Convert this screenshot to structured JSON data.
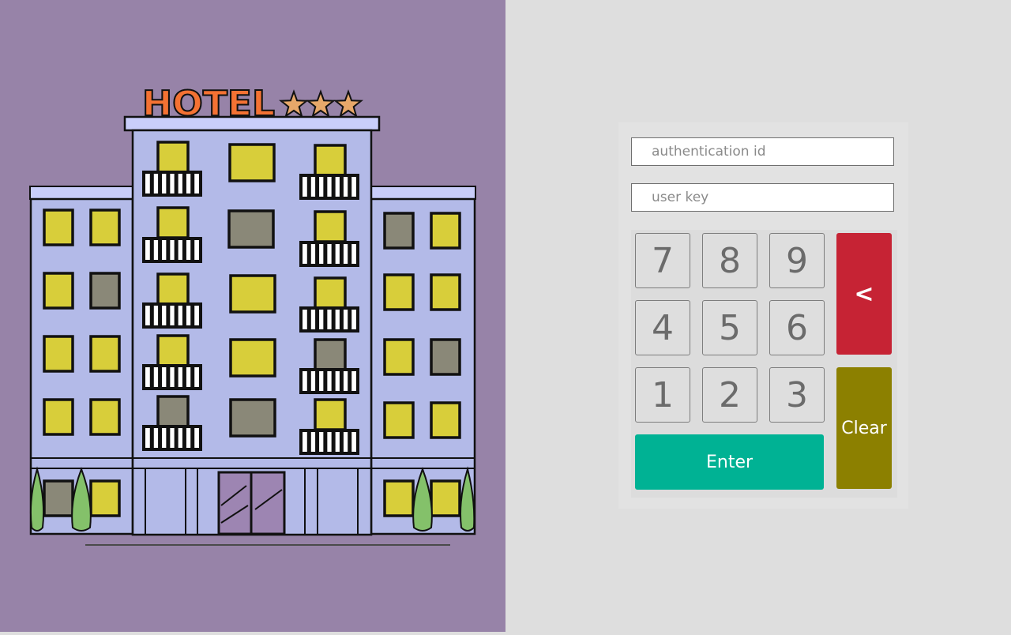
{
  "illustration": {
    "sign_text": "HOTEL",
    "star_count": 3,
    "colors": {
      "background": "#9783a8",
      "building": "#b3bae8",
      "window_lit": "#d8ce3a",
      "window_dark": "#8a8878",
      "sign": "#f47233",
      "stars": "#e7a86a",
      "trees": "#84c16a",
      "door": "#9d85b2"
    }
  },
  "login": {
    "auth_placeholder": "authentication id",
    "key_placeholder": "user key"
  },
  "keypad": {
    "keys": [
      "7",
      "8",
      "9",
      "4",
      "5",
      "6",
      "1",
      "2",
      "3"
    ],
    "backspace_symbol": "<",
    "clear_label": "Clear",
    "enter_label": "Enter",
    "colors": {
      "backspace": "#c62334",
      "clear": "#8c8000",
      "enter": "#00b294"
    }
  }
}
